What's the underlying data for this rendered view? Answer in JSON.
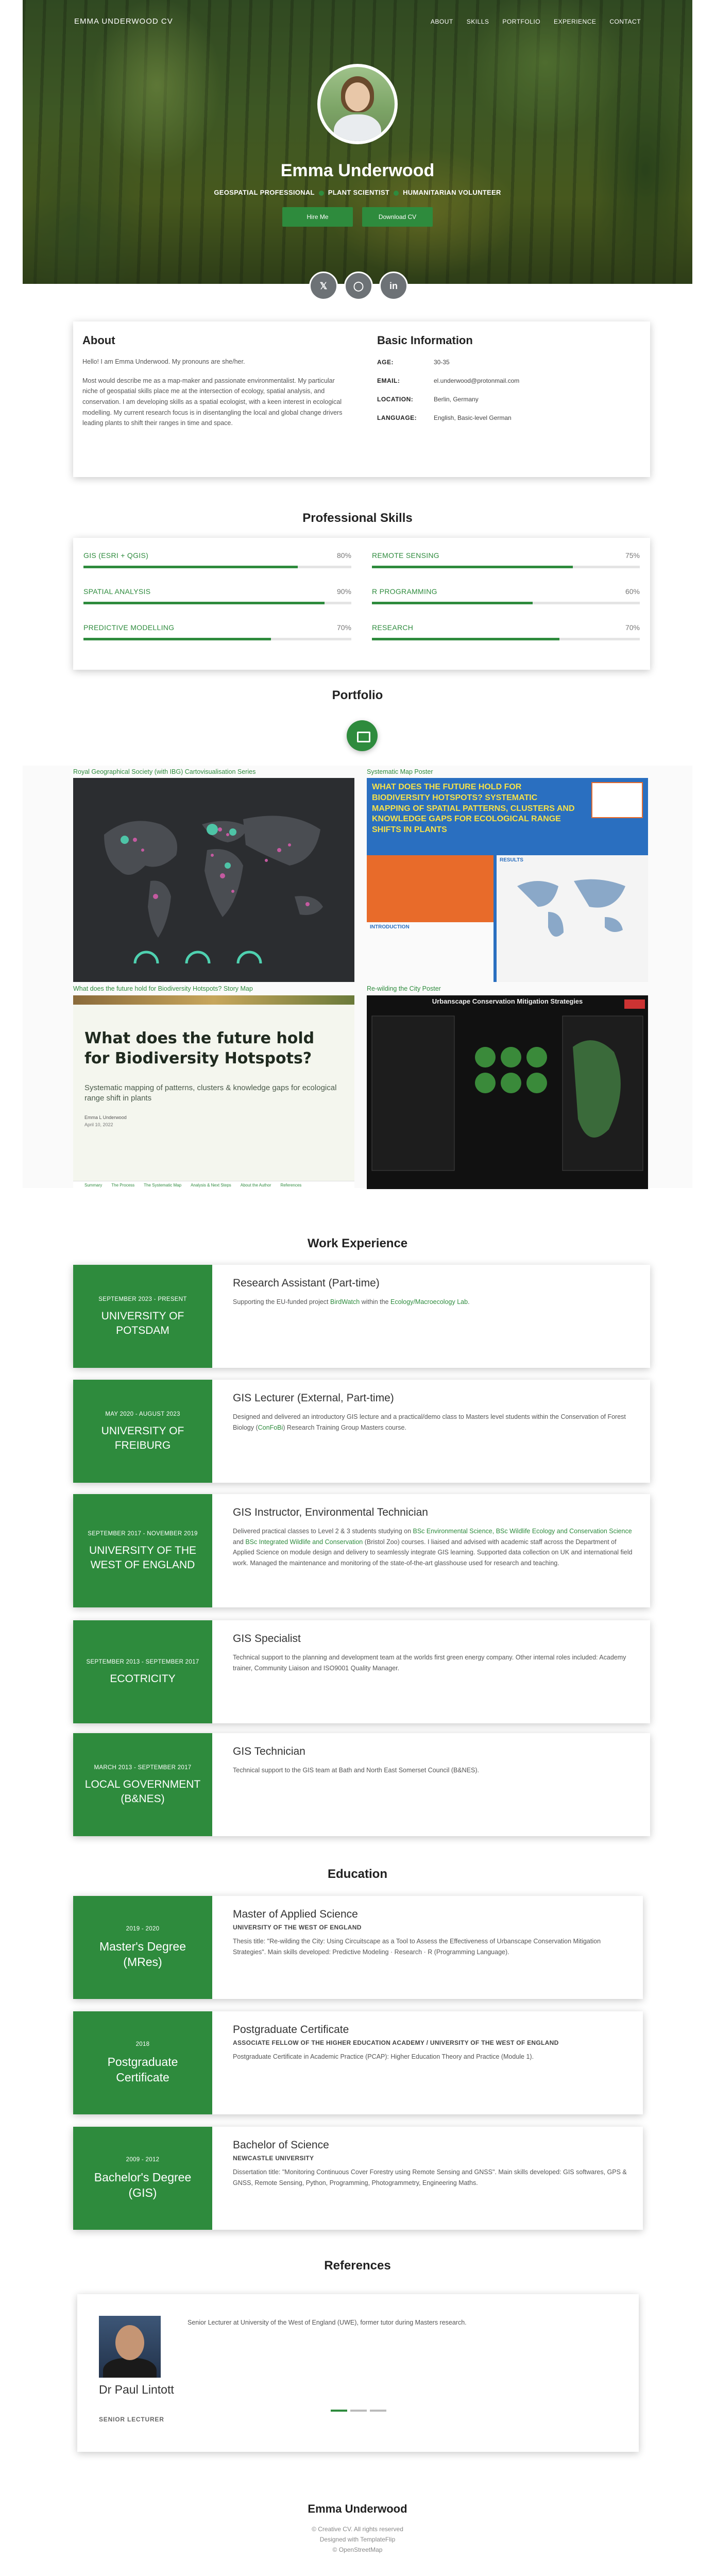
{
  "nav": {
    "brand": "EMMA UNDERWOOD CV",
    "links": [
      "ABOUT",
      "SKILLS",
      "PORTFOLIO",
      "EXPERIENCE",
      "CONTACT"
    ]
  },
  "hero": {
    "name": "Emma Underwood",
    "tags": [
      "GEOSPATIAL PROFESSIONAL",
      "PLANT SCIENTIST",
      "HUMANITARIAN VOLUNTEER"
    ],
    "hire_label": "Hire Me",
    "download_label": "Download CV",
    "socials": [
      "twitter-icon",
      "instagram-icon",
      "linkedin-icon"
    ]
  },
  "about": {
    "title": "About",
    "intro": "Hello! I am Emma Underwood. My pronouns are she/her.",
    "body": "Most would describe me as a map-maker and passionate environmentalist. My particular niche of geospatial skills place me at the intersection of ecology, spatial analysis, and conservation. I am developing skills as a spatial ecologist, with a keen interest in ecological modelling. My current research focus is in disentangling the local and global change drivers leading plants to shift their ranges in time and space.",
    "basic_title": "Basic Information",
    "info": [
      {
        "label": "AGE:",
        "value": "30-35"
      },
      {
        "label": "EMAIL:",
        "value": "el.underwood@protonmail.com"
      },
      {
        "label": "LOCATION:",
        "value": "Berlin, Germany"
      },
      {
        "label": "LANGUAGE:",
        "value": "English, Basic-level German"
      }
    ]
  },
  "skills": {
    "title": "Professional Skills",
    "items": [
      {
        "label": "GIS (ESRI + QGIS)",
        "pct": "80%",
        "value": 80
      },
      {
        "label": "REMOTE SENSING",
        "pct": "75%",
        "value": 75
      },
      {
        "label": "SPATIAL ANALYSIS",
        "pct": "90%",
        "value": 90
      },
      {
        "label": "R PROGRAMMING",
        "pct": "60%",
        "value": 60
      },
      {
        "label": "PREDICTIVE MODELLING",
        "pct": "70%",
        "value": 70
      },
      {
        "label": "RESEARCH",
        "pct": "70%",
        "value": 70
      }
    ]
  },
  "portfolio": {
    "title": "Portfolio",
    "captions": [
      "Royal Geographical Society (with IBG) Cartovisualisation Series",
      "Systematic Map Poster",
      "What does the future hold for Biodiversity Hotspots? Story Map",
      "Re-wilding the City Poster"
    ],
    "poster_title": "WHAT DOES THE FUTURE HOLD FOR BIODIVERSITY HOTSPOTS? SYSTEMATIC MAPPING OF SPATIAL PATTERNS, CLUSTERS AND KNOWLEDGE GAPS FOR ECOLOGICAL RANGE SHIFTS IN PLANTS",
    "poster_results": "RESULTS",
    "poster_intro": "INTRODUCTION",
    "story_title": "What does the future hold for Biodiversity Hotspots?",
    "story_sub": "Systematic mapping of patterns, clusters & knowledge gaps for ecological range shift in plants",
    "story_author": "Emma L Underwood",
    "story_date": "April 10, 2022",
    "story_tabs": [
      "Summary",
      "The Process",
      "The Systematic Map",
      "Analysis & Next Steps",
      "About the Author",
      "References"
    ],
    "rewild_title": "Urbanscape Conservation Mitigation Strategies"
  },
  "experience": {
    "title": "Work Experience",
    "items": [
      {
        "date": "SEPTEMBER 2023 - PRESENT",
        "org": "UNIVERSITY OF POTSDAM",
        "role": "Research Assistant (Part-time)",
        "desc_pre": "Supporting the EU-funded project ",
        "link1": "BirdWatch",
        "desc_mid": " within the ",
        "link2": "Ecology/Macroecology Lab",
        "desc_post": "."
      },
      {
        "date": "MAY 2020 - AUGUST 2023",
        "org": "UNIVERSITY OF FREIBURG",
        "role": "GIS Lecturer (External, Part-time)",
        "desc_pre": "Designed and delivered an introductory GIS lecture and a practical/demo class to Masters level students within the Conservation of Forest Biology (",
        "link1": "ConFoBi",
        "desc_mid": ") Research Training Group Masters course.",
        "link2": "",
        "desc_post": ""
      },
      {
        "date": "SEPTEMBER 2017 - NOVEMBER 2019",
        "org": "UNIVERSITY OF THE WEST OF ENGLAND",
        "role": "GIS Instructor, Environmental Technician",
        "desc_pre": "Delivered practical classes to Level 2 & 3 students studying on ",
        "link1": "BSc Environmental Science, BSc Wildlife Ecology and Conservation Science",
        "desc_mid": " and ",
        "link2": "BSc Integrated Wildlife and Conservation",
        "desc_post": " (Bristol Zoo) courses. I liaised and advised with academic staff across the Department of Applied Science on module design and delivery to seamlessly integrate GIS learning. Supported data collection on UK and international field work. Managed the maintenance and monitoring of the state-of-the-art glasshouse used for research and teaching."
      },
      {
        "date": "SEPTEMBER 2013 - SEPTEMBER 2017",
        "org": "ECOTRICITY",
        "role": "GIS Specialist",
        "desc_pre": "Technical support to the planning and development team at the worlds first green energy company. Other internal roles included: Academy trainer, Community Liaison and ISO9001 Quality Manager.",
        "link1": "",
        "desc_mid": "",
        "link2": "",
        "desc_post": ""
      },
      {
        "date": "MARCH 2013 - SEPTEMBER 2017",
        "org": "LOCAL GOVERNMENT (B&NES)",
        "role": "GIS Technician",
        "desc_pre": "Technical support to the GIS team at Bath and North East Somerset Council (B&NES).",
        "link1": "",
        "desc_mid": "",
        "link2": "",
        "desc_post": ""
      }
    ]
  },
  "education": {
    "title": "Education",
    "items": [
      {
        "date": "2019 - 2020",
        "degree": "Master's Degree (MRes)",
        "title": "Master of Applied Science",
        "institution": "UNIVERSITY OF THE WEST OF ENGLAND",
        "desc": "Thesis title: \"Re-wilding the City: Using Circuitscape as a Tool to Assess the Effectiveness of Urbanscape Conservation Mitigation Strategies\". Main skills developed: Predictive Modeling · Research · R (Programming Language)."
      },
      {
        "date": "2018",
        "degree": "Postgraduate Certificate",
        "title": "Postgraduate Certificate",
        "institution": "ASSOCIATE FELLOW OF THE HIGHER EDUCATION ACADEMY / UNIVERSITY OF THE WEST OF ENGLAND",
        "desc": "Postgraduate Certificate in Academic Practice (PCAP): Higher Education Theory and Practice (Module 1)."
      },
      {
        "date": "2009 - 2012",
        "degree": "Bachelor's Degree (GIS)",
        "title": "Bachelor of Science",
        "institution": "NEWCASTLE UNIVERSITY",
        "desc": "Dissertation title: \"Monitoring Continuous Cover Forestry using Remote Sensing and GNSS\". Main skills developed: GIS softwares, GPS & GNSS, Remote Sensing, Python, Programming, Photogrammetry, Engineering Maths."
      }
    ]
  },
  "references": {
    "title": "References",
    "name": "Dr Paul Lintott",
    "role": "SENIOR LECTURER",
    "quote": "Senior Lecturer at University of the West of England (UWE), former tutor during Masters research."
  },
  "footer": {
    "name": "Emma Underwood",
    "lines": [
      "© Creative CV. All rights reserved",
      "Designed with TemplateFlip",
      "© OpenStreetMap"
    ]
  },
  "colors": {
    "accent": "#2e8b3d"
  }
}
